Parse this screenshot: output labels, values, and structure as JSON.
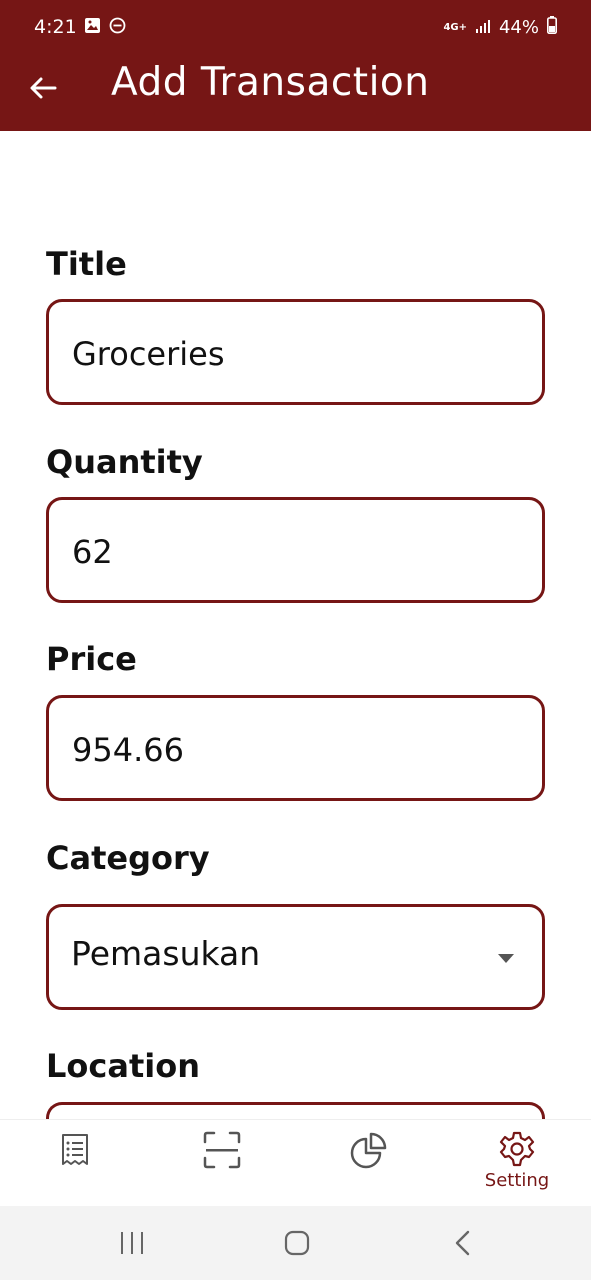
{
  "status": {
    "time": "4:21",
    "network": "4G+",
    "battery": "44%"
  },
  "appbar": {
    "title": "Add Transaction"
  },
  "form": {
    "title_label": "Title",
    "title_value": "Groceries",
    "quantity_label": "Quantity",
    "quantity_value": "62",
    "price_label": "Price",
    "price_value": "954.66",
    "category_label": "Category",
    "category_value": "Pemasukan",
    "location_label": "Location"
  },
  "bottom_nav": {
    "setting_label": "Setting"
  },
  "colors": {
    "primary": "#761615"
  }
}
